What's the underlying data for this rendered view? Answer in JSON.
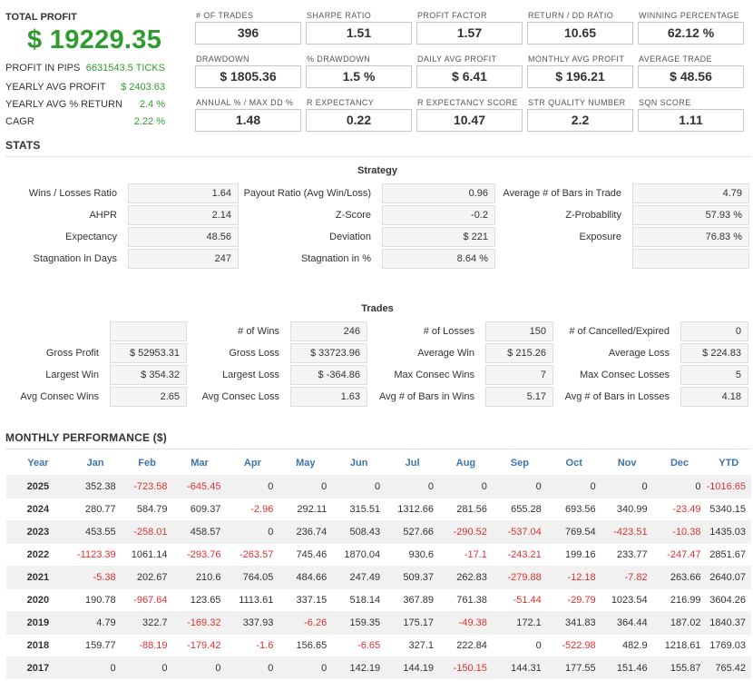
{
  "header": {
    "total_profit_label": "TOTAL PROFIT",
    "total_profit_value": "$ 19229.35",
    "info": [
      {
        "label": "PROFIT IN PIPS",
        "value": "6631543.5 TICKS"
      },
      {
        "label": "YEARLY AVG PROFIT",
        "value": "$ 2403.63"
      },
      {
        "label": "YEARLY AVG % RETURN",
        "value": "2.4 %"
      },
      {
        "label": "CAGR",
        "value": "2.22 %"
      }
    ]
  },
  "metrics": [
    {
      "label": "# OF TRADES",
      "value": "396"
    },
    {
      "label": "SHARPE RATIO",
      "value": "1.51"
    },
    {
      "label": "PROFIT FACTOR",
      "value": "1.57"
    },
    {
      "label": "RETURN / DD RATIO",
      "value": "10.65"
    },
    {
      "label": "WINNING PERCENTAGE",
      "value": "62.12 %"
    },
    {
      "label": "DRAWDOWN",
      "value": "$ 1805.36"
    },
    {
      "label": "% DRAWDOWN",
      "value": "1.5 %"
    },
    {
      "label": "DAILY AVG PROFIT",
      "value": "$ 6.41"
    },
    {
      "label": "MONTHLY AVG PROFIT",
      "value": "$ 196.21"
    },
    {
      "label": "AVERAGE TRADE",
      "value": "$ 48.56"
    },
    {
      "label": "ANNUAL % / MAX DD %",
      "value": "1.48"
    },
    {
      "label": "R EXPECTANCY",
      "value": "0.22"
    },
    {
      "label": "R EXPECTANCY SCORE",
      "value": "10.47"
    },
    {
      "label": "STR QUALITY NUMBER",
      "value": "2.2"
    },
    {
      "label": "SQN SCORE",
      "value": "1.11"
    }
  ],
  "stats_title": "STATS",
  "strategy": {
    "title": "Strategy",
    "rows": [
      [
        {
          "label": "Wins / Losses Ratio",
          "value": "1.64"
        },
        {
          "label": "Payout Ratio (Avg Win/Loss)",
          "value": "0.96"
        },
        {
          "label": "Average # of Bars in Trade",
          "value": "4.79"
        }
      ],
      [
        {
          "label": "AHPR",
          "value": "2.14"
        },
        {
          "label": "Z-Score",
          "value": "-0.2"
        },
        {
          "label": "Z-Probability",
          "value": "57.93 %"
        }
      ],
      [
        {
          "label": "Expectancy",
          "value": "48.56"
        },
        {
          "label": "Deviation",
          "value": "$ 221"
        },
        {
          "label": "Exposure",
          "value": "76.83 %"
        }
      ],
      [
        {
          "label": "Stagnation in Days",
          "value": "247"
        },
        {
          "label": "Stagnation in %",
          "value": "8.64 %"
        },
        {
          "label": "",
          "value": ""
        }
      ]
    ]
  },
  "trades": {
    "title": "Trades",
    "rows": [
      [
        {
          "label": "",
          "value": ""
        },
        {
          "label": "# of Wins",
          "value": "246"
        },
        {
          "label": "# of Losses",
          "value": "150"
        },
        {
          "label": "# of Cancelled/Expired",
          "value": "0"
        }
      ],
      [
        {
          "label": "Gross Profit",
          "value": "$ 52953.31"
        },
        {
          "label": "Gross Loss",
          "value": "$ 33723.96"
        },
        {
          "label": "Average Win",
          "value": "$ 215.26"
        },
        {
          "label": "Average Loss",
          "value": "$ 224.83"
        }
      ],
      [
        {
          "label": "Largest Win",
          "value": "$ 354.32"
        },
        {
          "label": "Largest Loss",
          "value": "$ -364.86"
        },
        {
          "label": "Max Consec Wins",
          "value": "7"
        },
        {
          "label": "Max Consec Losses",
          "value": "5"
        }
      ],
      [
        {
          "label": "Avg Consec Wins",
          "value": "2.65"
        },
        {
          "label": "Avg Consec Loss",
          "value": "1.63"
        },
        {
          "label": "Avg # of Bars in Wins",
          "value": "5.17"
        },
        {
          "label": "Avg # of Bars in Losses",
          "value": "4.18"
        }
      ]
    ]
  },
  "monthly": {
    "title": "MONTHLY PERFORMANCE ($)",
    "headers": [
      "Year",
      "Jan",
      "Feb",
      "Mar",
      "Apr",
      "May",
      "Jun",
      "Jul",
      "Aug",
      "Sep",
      "Oct",
      "Nov",
      "Dec",
      "YTD"
    ],
    "rows": [
      [
        "2025",
        "352.38",
        "-723.58",
        "-645.45",
        "0",
        "0",
        "0",
        "0",
        "0",
        "0",
        "0",
        "0",
        "0",
        "-1016.65"
      ],
      [
        "2024",
        "280.77",
        "584.79",
        "609.37",
        "-2.96",
        "292.11",
        "315.51",
        "1312.66",
        "281.56",
        "655.28",
        "693.56",
        "340.99",
        "-23.49",
        "5340.15"
      ],
      [
        "2023",
        "453.55",
        "-258.01",
        "458.57",
        "0",
        "236.74",
        "508.43",
        "527.66",
        "-290.52",
        "-537.04",
        "769.54",
        "-423.51",
        "-10.38",
        "1435.03"
      ],
      [
        "2022",
        "-1123.39",
        "1061.14",
        "-293.76",
        "-263.57",
        "745.46",
        "1870.04",
        "930.6",
        "-17.1",
        "-243.21",
        "199.16",
        "233.77",
        "-247.47",
        "2851.67"
      ],
      [
        "2021",
        "-5.38",
        "202.67",
        "210.6",
        "764.05",
        "484.66",
        "247.49",
        "509.37",
        "262.83",
        "-279.88",
        "-12.18",
        "-7.82",
        "263.66",
        "2640.07"
      ],
      [
        "2020",
        "190.78",
        "-967.64",
        "123.65",
        "1113.61",
        "337.15",
        "518.14",
        "367.89",
        "761.38",
        "-51.44",
        "-29.79",
        "1023.54",
        "216.99",
        "3604.26"
      ],
      [
        "2019",
        "4.79",
        "322.7",
        "-169.32",
        "337.93",
        "-6.26",
        "159.35",
        "175.17",
        "-49.38",
        "172.1",
        "341.83",
        "364.44",
        "187.02",
        "1840.37"
      ],
      [
        "2018",
        "159.77",
        "-88.19",
        "-179.42",
        "-1.6",
        "156.65",
        "-6.65",
        "327.1",
        "222.84",
        "0",
        "-522.98",
        "482.9",
        "1218.61",
        "1769.03"
      ],
      [
        "2017",
        "0",
        "0",
        "0",
        "0",
        "0",
        "142.19",
        "144.19",
        "-150.15",
        "144.31",
        "177.55",
        "151.46",
        "155.87",
        "765.42"
      ]
    ]
  },
  "colors": {
    "profit_green": "#2e9d2e",
    "negative_red": "#e03030",
    "header_blue": "#3d74b0"
  }
}
